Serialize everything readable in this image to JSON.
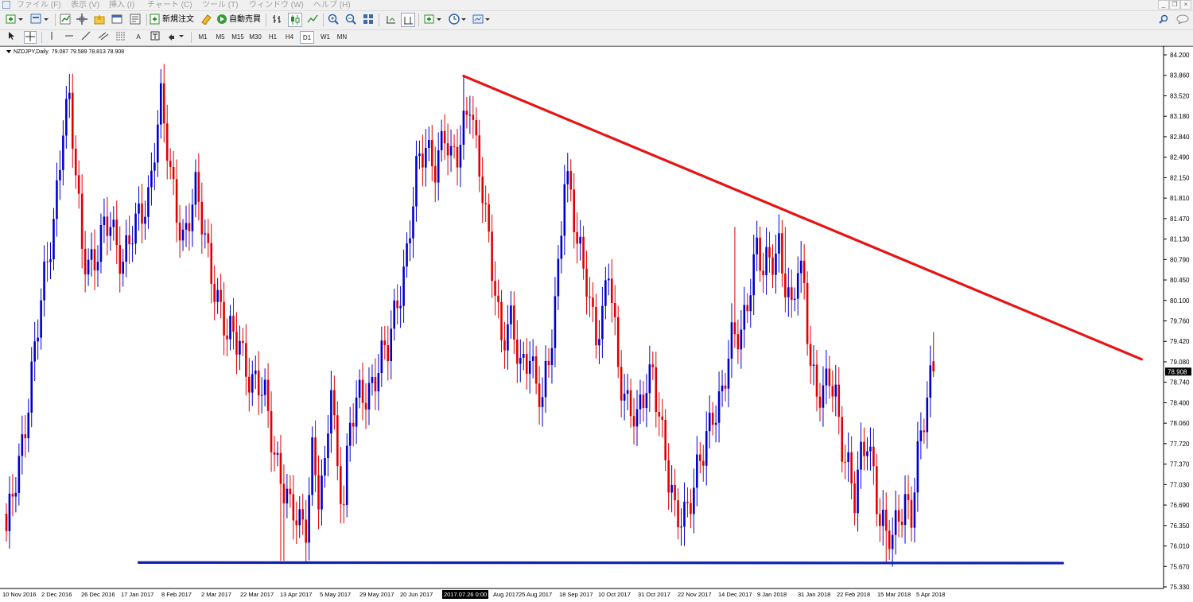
{
  "menu": {
    "items": [
      "ファイル (F)",
      "表示 (V)",
      "挿入 (I)",
      "チャート (C)",
      "ツール (T)",
      "ウィンドウ (W)",
      "ヘルプ (H)"
    ]
  },
  "toolbar": {
    "new_order_label": "新規注文",
    "auto_trading_label": "自動売買"
  },
  "timeframes": [
    "M1",
    "M5",
    "M15",
    "M30",
    "H1",
    "H4",
    "D1",
    "W1",
    "MN"
  ],
  "active_timeframe": "D1",
  "chart_info": {
    "symbol": "NZDJPY,Daily",
    "ohlc": "79.087 79.589 78.813 78.908",
    "current_price": "78.908",
    "crosshair_time": "2017.07.26 0:00"
  },
  "colors": {
    "bull_candle": "#0000cc",
    "bear_candle": "#e00000",
    "resistance_line": "#e61414",
    "support_line": "#1020b0",
    "price_label_bg": "#000000"
  },
  "chart_data": {
    "type": "candlestick",
    "symbol": "NZDJPY",
    "timeframe": "Daily",
    "y_ticks": [
      "84.200",
      "83.860",
      "83.520",
      "83.180",
      "82.840",
      "82.490",
      "82.150",
      "81.810",
      "81.470",
      "81.130",
      "80.790",
      "80.450",
      "80.100",
      "79.760",
      "79.420",
      "79.080",
      "78.740",
      "78.400",
      "78.060",
      "77.720",
      "77.370",
      "77.030",
      "76.690",
      "76.350",
      "76.010",
      "75.670",
      "75.330"
    ],
    "x_ticks": [
      "10 Nov 2016",
      "2 Dec 2016",
      "26 Dec 2016",
      "17 Jan 2017",
      "8 Feb 2017",
      "2 Mar 2017",
      "22 Mar 2017",
      "13 Apr 2017",
      "5 May 2017",
      "29 May 2017",
      "20 Jun 2017",
      "2017.07.26 0:00",
      "Aug 2017",
      "25 Aug 2017",
      "18 Sep 2017",
      "10 Oct 2017",
      "31 Oct 2017",
      "22 Nov 2017",
      "14 Dec 2017",
      "9 Jan 2018",
      "31 Jan 2018",
      "22 Feb 2018",
      "15 Mar 2018",
      "5 Apr 2018"
    ],
    "ylim": [
      75.2,
      84.35
    ],
    "anchors": [
      {
        "i": 0,
        "p": 76.0
      },
      {
        "i": 4,
        "p": 77.4
      },
      {
        "i": 10,
        "p": 79.6
      },
      {
        "i": 15,
        "p": 81.6
      },
      {
        "i": 18,
        "p": 83.2
      },
      {
        "i": 20,
        "p": 83.4
      },
      {
        "i": 24,
        "p": 81.1
      },
      {
        "i": 28,
        "p": 80.8
      },
      {
        "i": 33,
        "p": 81.5
      },
      {
        "i": 37,
        "p": 80.9
      },
      {
        "i": 41,
        "p": 81.3
      },
      {
        "i": 45,
        "p": 82.0
      },
      {
        "i": 47,
        "p": 82.9
      },
      {
        "i": 49,
        "p": 83.5
      },
      {
        "i": 52,
        "p": 82.2
      },
      {
        "i": 56,
        "p": 81.3
      },
      {
        "i": 60,
        "p": 81.9
      },
      {
        "i": 63,
        "p": 81.2
      },
      {
        "i": 66,
        "p": 80.5
      },
      {
        "i": 70,
        "p": 79.4
      },
      {
        "i": 74,
        "p": 79.5
      },
      {
        "i": 78,
        "p": 78.7
      },
      {
        "i": 82,
        "p": 78.4
      },
      {
        "i": 86,
        "p": 77.4
      },
      {
        "i": 90,
        "p": 76.4
      },
      {
        "i": 93,
        "p": 76.3
      },
      {
        "i": 95,
        "p": 76.4
      },
      {
        "i": 97,
        "p": 77.6
      },
      {
        "i": 99,
        "p": 76.7
      },
      {
        "i": 101,
        "p": 77.0
      },
      {
        "i": 103,
        "p": 78.8
      },
      {
        "i": 105,
        "p": 77.3
      },
      {
        "i": 107,
        "p": 76.8
      },
      {
        "i": 109,
        "p": 77.9
      },
      {
        "i": 112,
        "p": 78.4
      },
      {
        "i": 115,
        "p": 78.7
      },
      {
        "i": 118,
        "p": 79.0
      },
      {
        "i": 121,
        "p": 79.2
      },
      {
        "i": 124,
        "p": 80.2
      },
      {
        "i": 127,
        "p": 81.0
      },
      {
        "i": 130,
        "p": 82.2
      },
      {
        "i": 133,
        "p": 82.8
      },
      {
        "i": 136,
        "p": 82.6
      },
      {
        "i": 139,
        "p": 82.9
      },
      {
        "i": 141,
        "p": 82.4
      },
      {
        "i": 143,
        "p": 82.7
      },
      {
        "i": 145,
        "p": 83.3
      },
      {
        "i": 147,
        "p": 83.7
      },
      {
        "i": 149,
        "p": 82.6
      },
      {
        "i": 152,
        "p": 81.5
      },
      {
        "i": 155,
        "p": 80.5
      },
      {
        "i": 157,
        "p": 79.5
      },
      {
        "i": 160,
        "p": 79.6
      },
      {
        "i": 163,
        "p": 79.0
      },
      {
        "i": 166,
        "p": 79.4
      },
      {
        "i": 168,
        "p": 78.6
      },
      {
        "i": 170,
        "p": 78.3
      },
      {
        "i": 172,
        "p": 79.0
      },
      {
        "i": 175,
        "p": 80.8
      },
      {
        "i": 177,
        "p": 82.4
      },
      {
        "i": 179,
        "p": 81.8
      },
      {
        "i": 181,
        "p": 81.0
      },
      {
        "i": 184,
        "p": 80.6
      },
      {
        "i": 187,
        "p": 79.6
      },
      {
        "i": 189,
        "p": 79.7
      },
      {
        "i": 191,
        "p": 80.6
      },
      {
        "i": 194,
        "p": 79.1
      },
      {
        "i": 197,
        "p": 78.4
      },
      {
        "i": 200,
        "p": 77.9
      },
      {
        "i": 203,
        "p": 78.7
      },
      {
        "i": 205,
        "p": 79.1
      },
      {
        "i": 207,
        "p": 78.2
      },
      {
        "i": 210,
        "p": 76.9
      },
      {
        "i": 212,
        "p": 76.4
      },
      {
        "i": 215,
        "p": 76.6
      },
      {
        "i": 218,
        "p": 76.9
      },
      {
        "i": 221,
        "p": 77.4
      },
      {
        "i": 224,
        "p": 78.3
      },
      {
        "i": 227,
        "p": 78.6
      },
      {
        "i": 230,
        "p": 79.3
      },
      {
        "i": 233,
        "p": 79.6
      },
      {
        "i": 236,
        "p": 80.6
      },
      {
        "i": 238,
        "p": 81.0
      },
      {
        "i": 240,
        "p": 80.5
      },
      {
        "i": 243,
        "p": 80.9
      },
      {
        "i": 245,
        "p": 81.2
      },
      {
        "i": 247,
        "p": 80.5
      },
      {
        "i": 249,
        "p": 79.8
      },
      {
        "i": 251,
        "p": 80.6
      },
      {
        "i": 253,
        "p": 80.4
      },
      {
        "i": 255,
        "p": 79.2
      },
      {
        "i": 257,
        "p": 78.6
      },
      {
        "i": 259,
        "p": 78.4
      },
      {
        "i": 261,
        "p": 78.7
      },
      {
        "i": 263,
        "p": 78.5
      },
      {
        "i": 265,
        "p": 77.8
      },
      {
        "i": 267,
        "p": 77.3
      },
      {
        "i": 269,
        "p": 76.6
      },
      {
        "i": 271,
        "p": 77.3
      },
      {
        "i": 273,
        "p": 77.8
      },
      {
        "i": 275,
        "p": 77.3
      },
      {
        "i": 277,
        "p": 76.4
      },
      {
        "i": 279,
        "p": 76.0
      },
      {
        "i": 281,
        "p": 75.9
      },
      {
        "i": 283,
        "p": 76.5
      },
      {
        "i": 285,
        "p": 76.8
      },
      {
        "i": 287,
        "p": 76.5
      },
      {
        "i": 289,
        "p": 77.3
      },
      {
        "i": 291,
        "p": 78.0
      },
      {
        "i": 293,
        "p": 78.8
      },
      {
        "i": 294,
        "p": 78.91
      }
    ],
    "candle_count": 295,
    "trendlines": [
      {
        "name": "resistance",
        "color": "#e61414",
        "from": {
          "i": 145,
          "p": 84.0
        },
        "to": {
          "i": 360,
          "p": 79.12
        }
      },
      {
        "name": "support",
        "color": "#1020b0",
        "from": {
          "i": 42,
          "p": 75.62
        },
        "to": {
          "i": 335,
          "p": 75.61
        }
      }
    ],
    "annotations": []
  }
}
